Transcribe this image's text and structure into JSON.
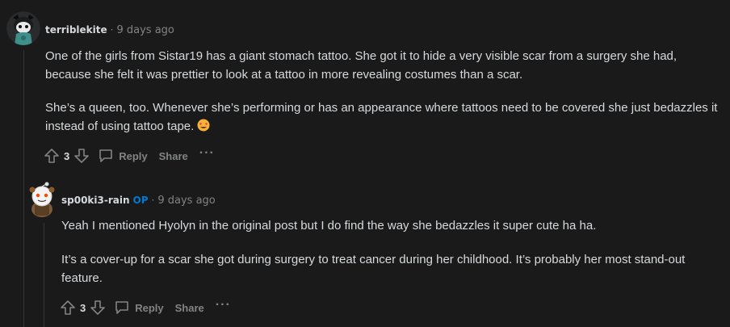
{
  "comments": [
    {
      "username": "terriblekite",
      "separator": "·",
      "time": "9 days ago",
      "paragraphs": [
        "One of the girls from Sistar19 has a giant stomach tattoo. She got it to hide a very visible scar from a surgery she had, because she felt it was prettier to look at a tattoo in more revealing costumes than a scar.",
        "She’s a queen, too. Whenever she’s performing or has an appearance where tattoos need to be covered she just bedazzles it instead of using tattoo tape."
      ],
      "score": "3",
      "reply_label": "Reply",
      "share_label": "Share",
      "more_label": "···"
    },
    {
      "username": "sp00ki3-rain",
      "op_badge": "OP",
      "separator": "·",
      "time": "9 days ago",
      "paragraphs": [
        "Yeah I mentioned Hyolyn in the original post but I do find the way she bedazzles it super cute ha ha.",
        "It’s a cover-up for a scar she got during surgery to treat cancer during her childhood. It’s probably her most stand-out feature."
      ],
      "score": "3",
      "reply_label": "Reply",
      "share_label": "Share",
      "more_label": "···"
    }
  ],
  "icons": {
    "upvote": "arrow-up-outline",
    "downvote": "arrow-down-outline",
    "reply": "speech-bubble-outline",
    "emoji": "star-struck-face",
    "avatar_1": "snoo-avatar-teal",
    "avatar_2": "snoo-avatar-brown"
  },
  "colors": {
    "background": "#1a1a1b",
    "text": "#d7dadc",
    "muted": "#818384",
    "op": "#0079d3",
    "thread_line": "#343536"
  }
}
